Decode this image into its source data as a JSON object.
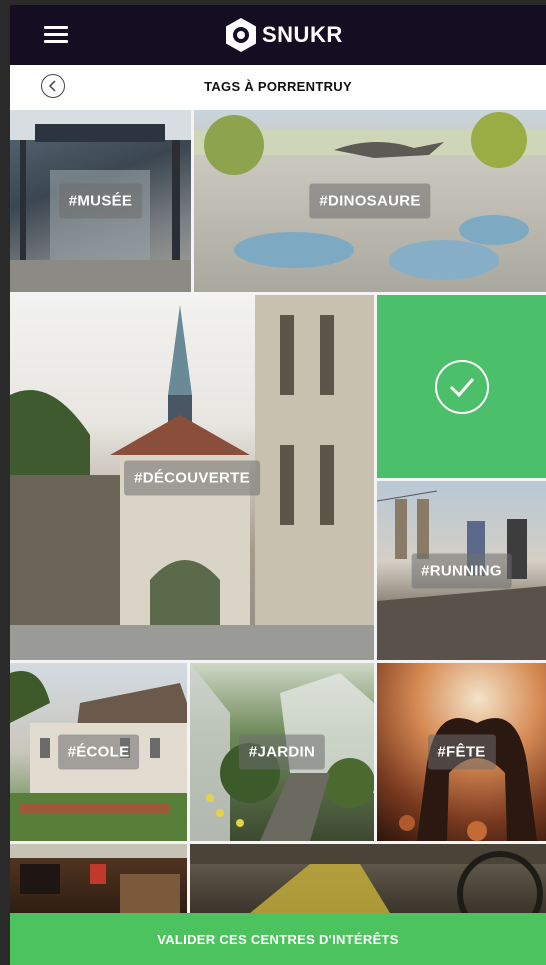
{
  "app": {
    "brand": "SNUKR"
  },
  "header": {
    "title": "TAGS À PORRENTRUY"
  },
  "tags": [
    {
      "label": "#MUSÉE",
      "selected": false
    },
    {
      "label": "#DINOSAURE",
      "selected": false
    },
    {
      "label": "#DÉCOUVERTE",
      "selected": false
    },
    {
      "label": "",
      "selected": true
    },
    {
      "label": "#RUNNING",
      "selected": false
    },
    {
      "label": "#ÉCOLE",
      "selected": false
    },
    {
      "label": "#JARDIN",
      "selected": false
    },
    {
      "label": "#FÊTE",
      "selected": false
    }
  ],
  "footer": {
    "validate_label": "VALIDER CES CENTRES D'INTÉRÊTS"
  },
  "colors": {
    "topbar": "#150e22",
    "accent_green": "#4cc35f"
  }
}
